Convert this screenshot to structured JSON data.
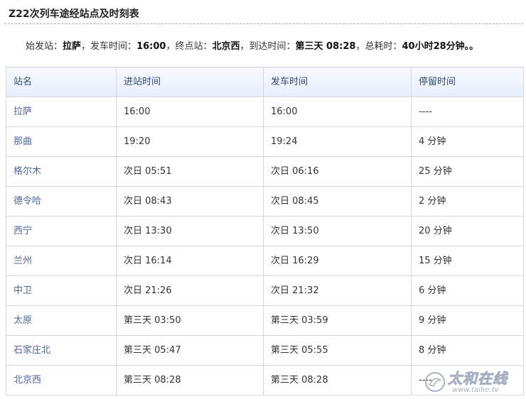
{
  "page": {
    "title": "Z22次列车途经站点及时刻表"
  },
  "summary": {
    "origin_label": "始发站：",
    "origin": "拉萨",
    "sep1": "，",
    "depart_label": "发车时间：",
    "depart_time": "16:00",
    "sep2": "，",
    "terminal_label": "终点站：",
    "terminal": "北京西",
    "sep3": "，",
    "arrive_label": "到达时间：",
    "arrive_time": "第三天 08:28",
    "sep4": "，",
    "duration_label": "总耗时：",
    "duration": "40小时28分钟。",
    "end": "。"
  },
  "table": {
    "headers": [
      "站名",
      "进站时间",
      "发车时间",
      "停留时间"
    ],
    "rows": [
      [
        "拉萨",
        "16:00",
        "16:00",
        "----"
      ],
      [
        "那曲",
        "19:20",
        "19:24",
        "4 分钟"
      ],
      [
        "格尔木",
        "次日 05:51",
        "次日 06:16",
        "25 分钟"
      ],
      [
        "德令哈",
        "次日 08:43",
        "次日 08:45",
        "2 分钟"
      ],
      [
        "西宁",
        "次日 13:30",
        "次日 13:50",
        "20 分钟"
      ],
      [
        "兰州",
        "次日 16:14",
        "次日 16:29",
        "15 分钟"
      ],
      [
        "中卫",
        "次日 21:26",
        "次日 21:32",
        "6 分钟"
      ],
      [
        "太原",
        "第三天 03:50",
        "第三天 03:59",
        "9 分钟"
      ],
      [
        "石家庄北",
        "第三天 05:47",
        "第三天 05:55",
        "8 分钟"
      ],
      [
        "北京西",
        "第三天 08:28",
        "第三天 08:28",
        "----"
      ]
    ]
  },
  "watermark": {
    "logo_icon": "taihe-logo-icon",
    "brand": "太和在线",
    "url": "www.taihe.tv"
  },
  "colors": {
    "header_gradient_top": "#f7faff",
    "header_gradient_bottom": "#e6eefb",
    "border": "#d3d7de",
    "station_text": "#4e66a0"
  }
}
